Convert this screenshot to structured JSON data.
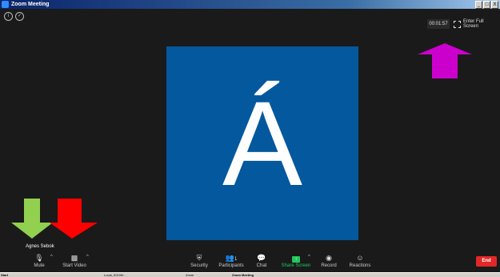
{
  "window": {
    "title": "Zoom Meeting",
    "buttons": [
      "_",
      "□",
      "X"
    ]
  },
  "meeting": {
    "timer": "00:01:57",
    "fullscreen_label": "Enter Full Screen",
    "avatar_letter": "Á",
    "participant_name": "Agnes Sebok",
    "avatar_color": "#04589e"
  },
  "toolbar": {
    "mute": "Mute",
    "start_video": "Start Video",
    "security": "Security",
    "participants": "Participants",
    "participants_count": "1",
    "chat": "Chat",
    "share_screen": "Share Screen",
    "record": "Record",
    "reactions": "Reactions",
    "end": "End",
    "share_color": "#22c55e",
    "end_color": "#e02828"
  },
  "taskbar": {
    "start": "Start",
    "items": [
      "Local_ZOOM...",
      "Zoom",
      "Zoom Meeting"
    ]
  },
  "annotations": {
    "colors": [
      "#92d050",
      "#ff0000",
      "#cc00cc"
    ]
  }
}
